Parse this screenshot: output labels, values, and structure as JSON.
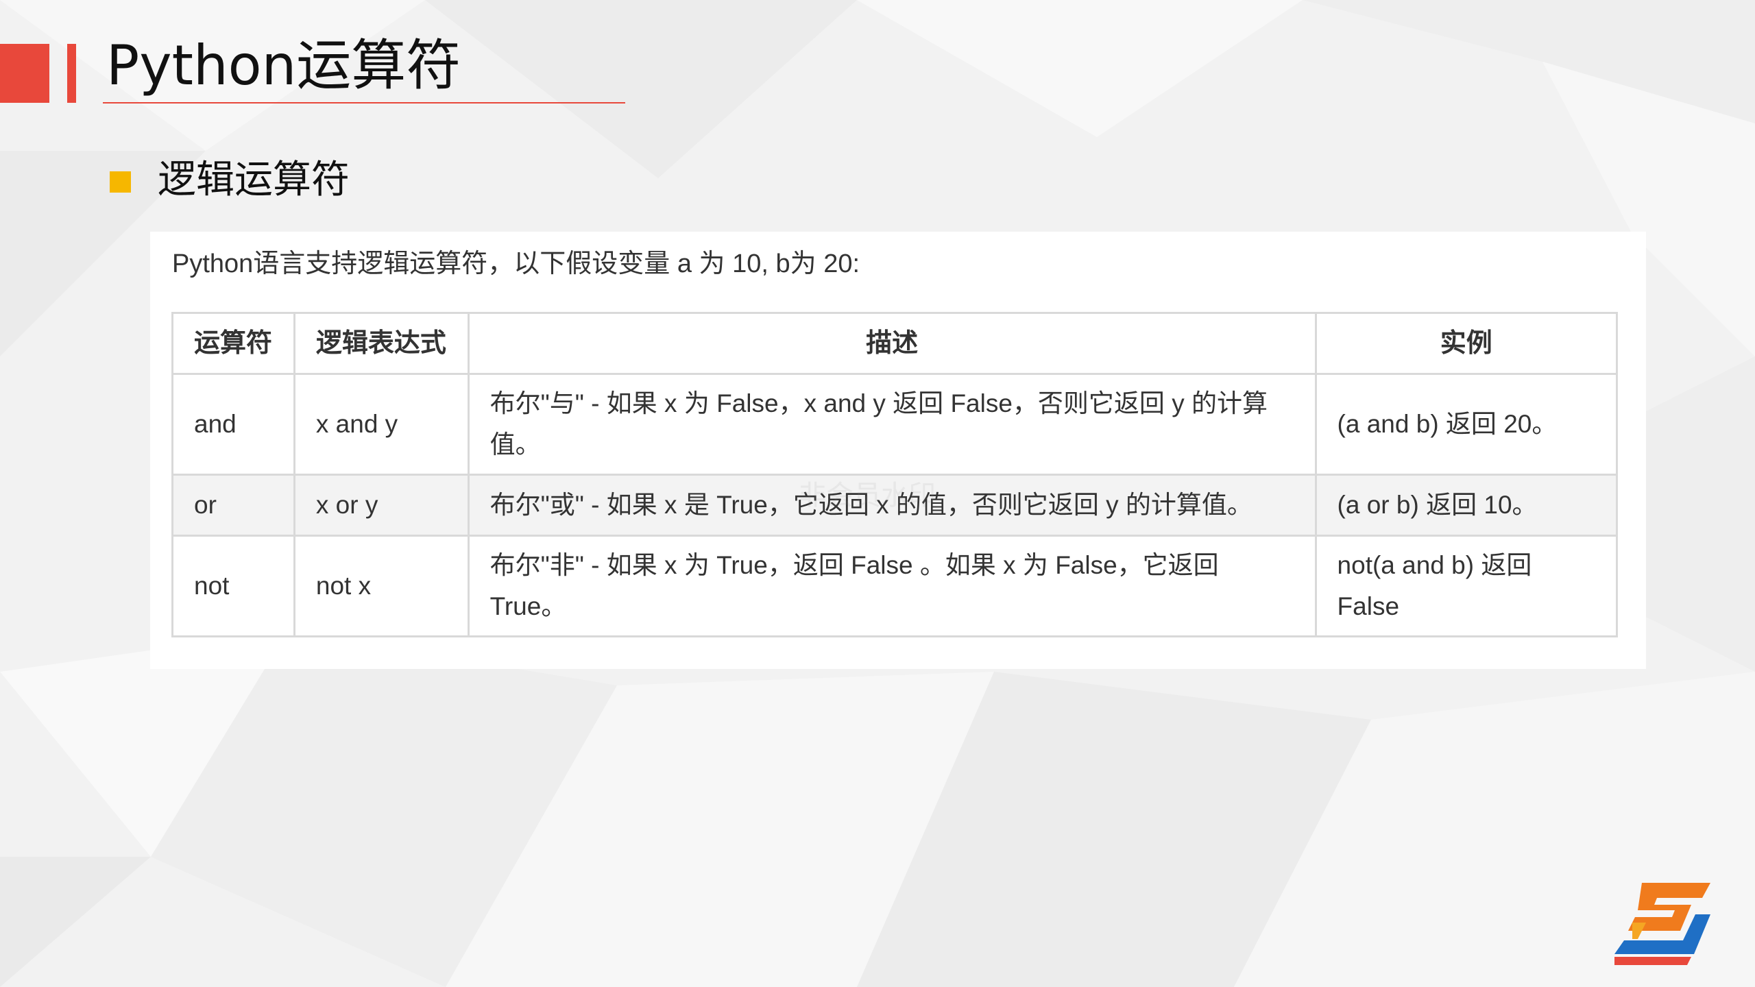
{
  "slide": {
    "title": "Python运算符",
    "section_title": "逻辑运算符",
    "intro": "Python语言支持逻辑运算符，以下假设变量 a 为 10, b为 20:",
    "watermark": "非会员水印"
  },
  "table": {
    "headers": [
      "运算符",
      "逻辑表达式",
      "描述",
      "实例"
    ],
    "rows": [
      {
        "operator": "and",
        "expression": "x and y",
        "description": "布尔\"与\" - 如果 x 为 False，x and y 返回 False，否则它返回 y 的计算值。",
        "example": "(a and b) 返回 20。"
      },
      {
        "operator": "or",
        "expression": "x or y",
        "description": "布尔\"或\" - 如果 x 是 True，它返回 x 的值，否则它返回 y 的计算值。",
        "example": "(a or b) 返回 10。"
      },
      {
        "operator": "not",
        "expression": "not x",
        "description": "布尔\"非\" - 如果 x 为 True，返回 False 。如果 x 为 False，它返回 True。",
        "example": "not(a and b) 返回 False"
      }
    ]
  },
  "colors": {
    "accent_red": "#e8483b",
    "bullet_yellow": "#f6b700",
    "logo_orange": "#f07b1d",
    "logo_blue": "#1f6fc5"
  },
  "icons": {
    "logo": "s-logo-icon",
    "bullet": "square-bullet-icon"
  }
}
